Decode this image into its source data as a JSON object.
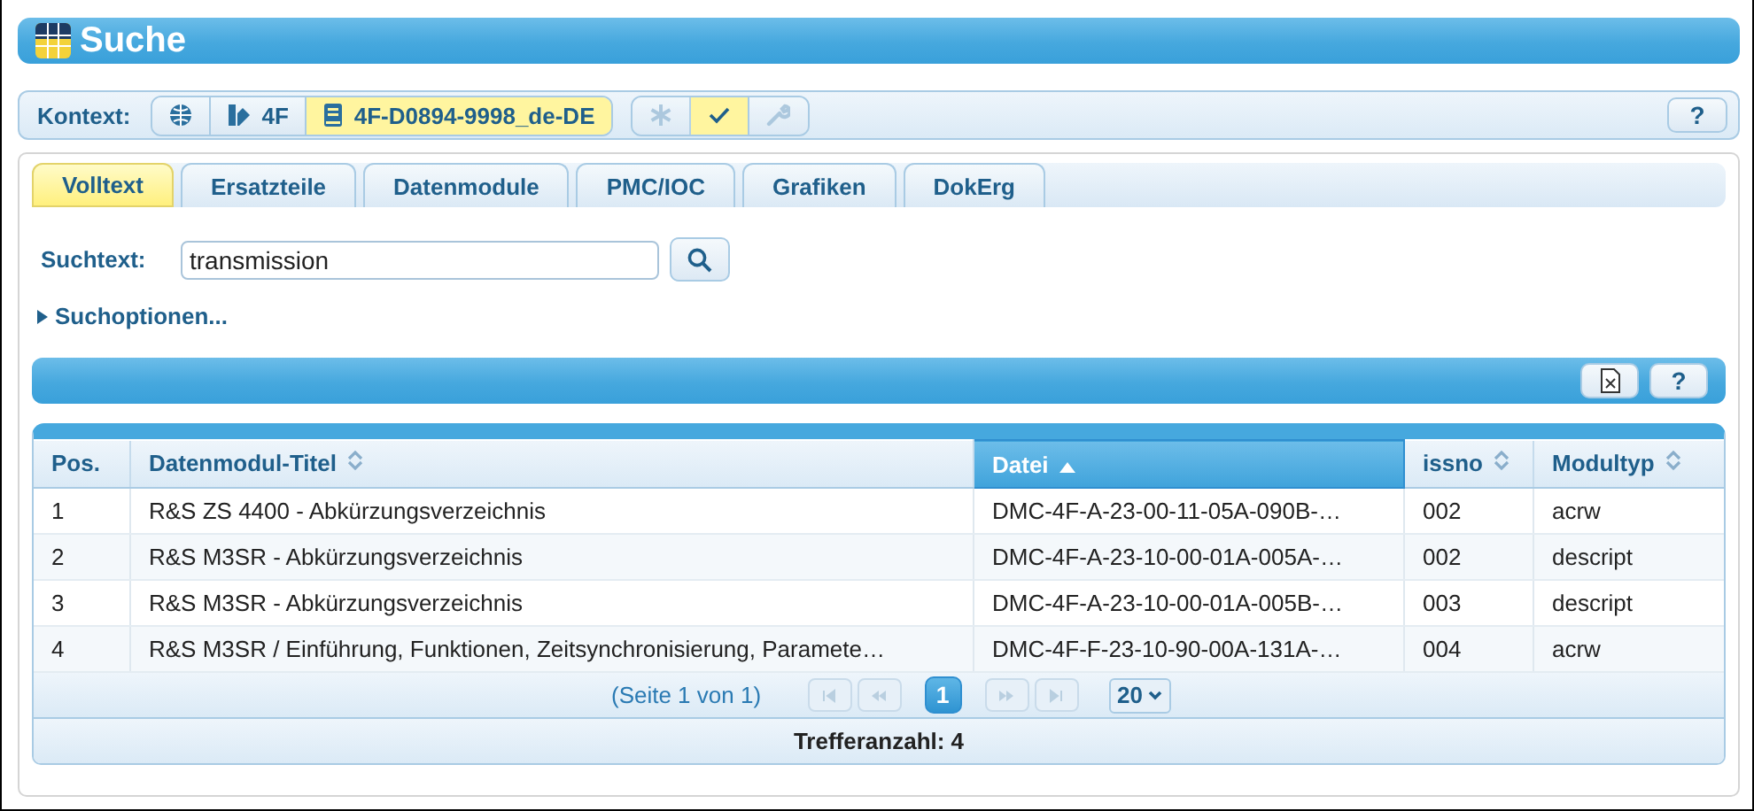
{
  "window": {
    "title": "Suche"
  },
  "context": {
    "label": "Kontext:",
    "segments": [
      {
        "kind": "globe",
        "selected": false
      },
      {
        "kind": "catalog",
        "text": "4F",
        "selected": false
      },
      {
        "kind": "book",
        "text": "4F-D0894-9998_de-DE",
        "selected": true
      }
    ],
    "tools": [
      {
        "kind": "asterisk",
        "disabled": true,
        "selected": false
      },
      {
        "kind": "check",
        "disabled": false,
        "selected": true
      },
      {
        "kind": "wrench",
        "disabled": true,
        "selected": false
      }
    ],
    "help": "?"
  },
  "tabs": [
    {
      "label": "Volltext",
      "selected": true
    },
    {
      "label": "Ersatzteile",
      "selected": false
    },
    {
      "label": "Datenmodule",
      "selected": false
    },
    {
      "label": "PMC/IOC",
      "selected": false
    },
    {
      "label": "Grafiken",
      "selected": false
    },
    {
      "label": "DokErg",
      "selected": false
    }
  ],
  "search": {
    "label": "Suchtext:",
    "value": "transmission",
    "options": "Suchoptionen...",
    "expanded": false
  },
  "results_toolbar": {
    "help": "?"
  },
  "table": {
    "columns": [
      {
        "label": "Pos.",
        "sorted": false,
        "sortable": false
      },
      {
        "label": "Datenmodul-Titel",
        "sorted": false,
        "sortable": true
      },
      {
        "label": "Datei",
        "sorted": true,
        "sortable": true
      },
      {
        "label": "issno",
        "sorted": false,
        "sortable": true
      },
      {
        "label": "Modultyp",
        "sorted": false,
        "sortable": true
      }
    ],
    "rows": [
      [
        "1",
        "R&S ZS 4400 - Abkürzungsverzeichnis",
        "DMC-4F-A-23-00-11-05A-090B-…",
        "002",
        "acrw"
      ],
      [
        "2",
        "R&S M3SR - Abkürzungsverzeichnis",
        "DMC-4F-A-23-10-00-01A-005A-…",
        "002",
        "descript"
      ],
      [
        "3",
        "R&S M3SR - Abkürzungsverzeichnis",
        "DMC-4F-A-23-10-00-01A-005B-…",
        "003",
        "descript"
      ],
      [
        "4",
        "R&S M3SR / Einführung, Funktionen, Zeitsynchronisierung, Paramete…",
        "DMC-4F-F-23-10-90-00A-131A-…",
        "004",
        "acrw"
      ]
    ]
  },
  "pager": {
    "info": "(Seite 1 von 1)",
    "first_disabled": true,
    "prev_disabled": true,
    "next_disabled": true,
    "last_disabled": true,
    "pages": [
      {
        "label": "1",
        "selected": true
      }
    ],
    "page_size": "20"
  },
  "footer": {
    "text": "Trefferanzahl: 4"
  }
}
